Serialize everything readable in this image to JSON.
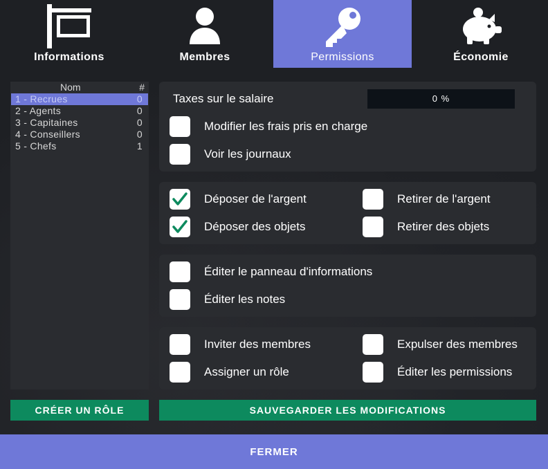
{
  "tabs": [
    {
      "label": "Informations",
      "icon": "sign-post-icon",
      "active": false
    },
    {
      "label": "Membres",
      "icon": "user-icon",
      "active": false
    },
    {
      "label": "Permissions",
      "icon": "key-icon",
      "active": true
    },
    {
      "label": "Économie",
      "icon": "piggy-bank-icon",
      "active": false
    }
  ],
  "roles": {
    "header": {
      "name": "Nom",
      "count": "#"
    },
    "items": [
      {
        "name": "1 - Recrues",
        "count": "0",
        "selected": true
      },
      {
        "name": "2 - Agents",
        "count": "0",
        "selected": false
      },
      {
        "name": "3 - Capitaines",
        "count": "0",
        "selected": false
      },
      {
        "name": "4 - Conseillers",
        "count": "0",
        "selected": false
      },
      {
        "name": "5 - Chefs",
        "count": "1",
        "selected": false
      }
    ]
  },
  "tax": {
    "label": "Taxes sur le salaire",
    "value_text": "0 %",
    "value": 0
  },
  "permissions": {
    "salary": [
      {
        "label": "Modifier les frais pris en charge",
        "checked": false
      },
      {
        "label": "Voir les journaux",
        "checked": false
      }
    ],
    "money": [
      {
        "label": "Déposer de l'argent",
        "checked": true
      },
      {
        "label": "Retirer de l'argent",
        "checked": false
      },
      {
        "label": "Déposer des objets",
        "checked": true
      },
      {
        "label": "Retirer des objets",
        "checked": false
      }
    ],
    "info": [
      {
        "label": "Éditer le panneau d'informations",
        "checked": false
      },
      {
        "label": "Éditer les notes",
        "checked": false
      }
    ],
    "members": [
      {
        "label": "Inviter des membres",
        "checked": false
      },
      {
        "label": "Expulser des membres",
        "checked": false
      },
      {
        "label": "Assigner un rôle",
        "checked": false
      },
      {
        "label": "Éditer les permissions",
        "checked": false
      }
    ]
  },
  "buttons": {
    "create_role": "CRÉER UN RÔLE",
    "save": "SAUVEGARDER LES MODIFICATIONS",
    "close": "FERMER"
  },
  "colors": {
    "accent": "#6f78d8",
    "button_green": "#0d8a5e",
    "check_green": "#0d8a5e",
    "panel": "#2a2c30"
  }
}
